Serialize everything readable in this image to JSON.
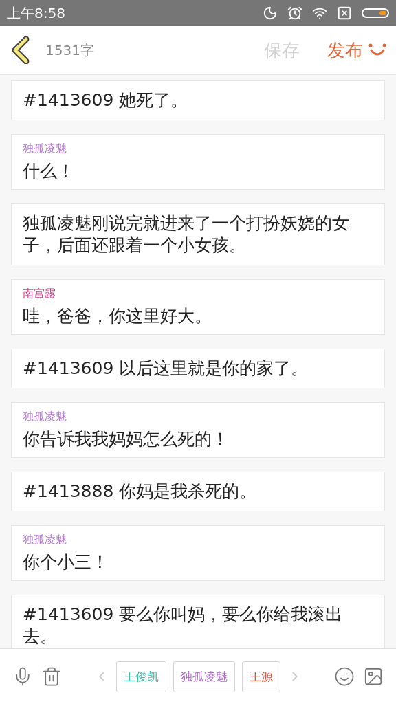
{
  "status_bar": {
    "time": "上午8:58"
  },
  "header": {
    "word_count": "1531字",
    "save": {
      "label": "保存",
      "disabled": true
    },
    "publish": {
      "label": "发布"
    }
  },
  "entries": [
    {
      "kind": "narration",
      "text": "#1413609 她死了。"
    },
    {
      "kind": "dialogue",
      "speaker": "独孤凌魅",
      "color": "#b57ad6",
      "text": "什么！"
    },
    {
      "kind": "narration",
      "text": "独孤凌魅刚说完就进来了一个打扮妖娆的女子，后面还跟着一个小女孩。"
    },
    {
      "kind": "dialogue",
      "speaker": "南宫露",
      "color": "#d63a8c",
      "text": "哇，爸爸，你这里好大。"
    },
    {
      "kind": "narration",
      "text": "#1413609 以后这里就是你的家了。"
    },
    {
      "kind": "dialogue",
      "speaker": "独孤凌魅",
      "color": "#b57ad6",
      "text": "你告诉我我妈妈怎么死的！"
    },
    {
      "kind": "narration",
      "text": "#1413888 你妈是我杀死的。"
    },
    {
      "kind": "dialogue",
      "speaker": "独孤凌魅",
      "color": "#b57ad6",
      "text": "你个小三！"
    },
    {
      "kind": "narration",
      "text": "#1413609 要么你叫妈，要么你给我滚出去。"
    }
  ],
  "characters": [
    {
      "name": "王俊凯",
      "color": "#3cbfa5"
    },
    {
      "name": "独孤凌魅",
      "color": "#b06fd0"
    },
    {
      "name": "王源",
      "color": "#e0503a"
    }
  ]
}
